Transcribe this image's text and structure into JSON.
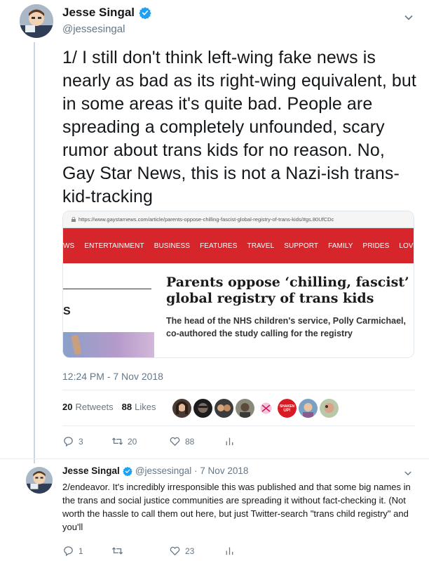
{
  "main_tweet": {
    "display_name": "Jesse Singal",
    "handle": "@jessesingal",
    "text": "1/ I still don't think left-wing fake news is nearly as bad as its right-wing equivalent, but in some areas it's quite bad. People are spreading a completely unfounded, scary rumor about trans kids for no reason. No, Gay Star News, this is not a Nazi-ish trans-kid-tracking",
    "timestamp": "12:24 PM - 7 Nov 2018",
    "retweets_count": "20",
    "retweets_label": "Retweets",
    "likes_count": "88",
    "likes_label": "Likes",
    "reply_count": "3",
    "retweet_action_count": "20",
    "like_action_count": "88"
  },
  "card": {
    "url": "https://www.gaystarnews.com/article/parents-oppose-chilling-fascist-global-registry-of-trans-kids/#gs.80UfCDc",
    "nav_items": [
      "WS",
      "ENTERTAINMENT",
      "BUSINESS",
      "FEATURES",
      "TRAVEL",
      "SUPPORT",
      "FAMILY",
      "PRIDES",
      "LOVE"
    ],
    "left_fragment": "S",
    "headline": "Parents oppose ‘chilling, fascist’ global registry of trans kids",
    "subhead": "The head of the NHS children's service, Polly Carmichael, co-authored the study calling for the registry",
    "liker_badge_text": "SHAKEN UP!"
  },
  "reply_tweet": {
    "display_name": "Jesse Singal",
    "handle_date": "@jessesingal · 7 Nov 2018",
    "text": "2/endeavor. It's incredibly irresponsible this was published and that some big names in the trans and social justice communities are spreading it without fact-checking it. (Not worth the hassle to call them out here, but just Twitter-search \"trans child registry\" and you'll",
    "reply_count": "1",
    "retweet_count": "",
    "like_count": "23"
  },
  "colors": {
    "text": "#14171a",
    "secondary": "#657786",
    "verified": "#1da1f2",
    "site_red": "#d7262b"
  }
}
